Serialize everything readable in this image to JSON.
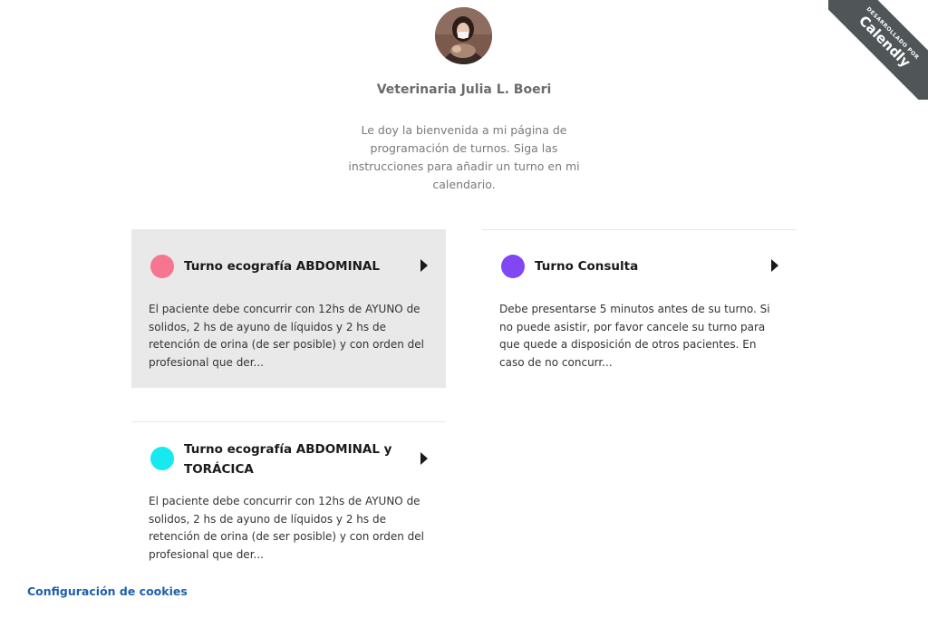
{
  "badge": {
    "small_text": "DESARROLLADO POR",
    "brand": "Calendly"
  },
  "header": {
    "host_name": "Veterinaria Julia L. Boeri",
    "welcome": "Le doy la bienvenida a mi página de programación de turnos. Siga las instrucciones para añadir un turno en mi calendario."
  },
  "events": [
    {
      "title": "Turno ecografía ABDOMINAL",
      "description": "El paciente debe concurrir con 12hs de AYUNO de solidos, 2 hs de ayuno de líquidos y 2 hs de retención de orina (de ser posible) y con orden del profesional que der...",
      "color": "#f7768f"
    },
    {
      "title": "Turno Consulta",
      "description": "Debe presentarse 5 minutos antes de su turno. Si no puede asistir, por favor cancele su turno para que quede a disposición de otros pacientes. En caso de no concurr...",
      "color": "#8247f5"
    },
    {
      "title": "Turno ecografía ABDOMINAL y TORÁCICA",
      "description": "El paciente debe concurrir con 12hs de AYUNO de solidos, 2 hs de ayuno de líquidos y 2 hs de retención de orina (de ser posible) y con orden del profesional que der...",
      "color": "#17e9f0"
    }
  ],
  "footer": {
    "cookies_link": "Configuración de cookies"
  }
}
